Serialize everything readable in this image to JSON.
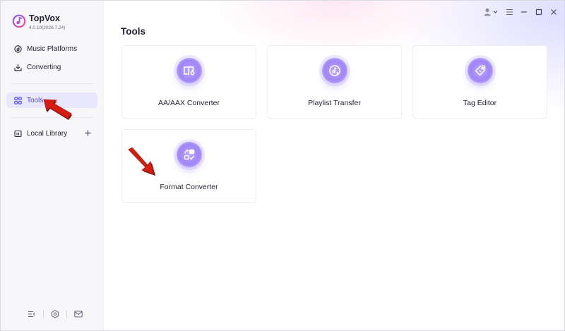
{
  "app": {
    "name": "TopVox",
    "version": "4.0.10(2026.7.24)"
  },
  "sidebar": {
    "items": [
      {
        "label": "Music Platforms",
        "icon": "music-platform-icon"
      },
      {
        "label": "Converting",
        "icon": "download-icon"
      },
      {
        "label": "Tools",
        "icon": "grid-icon",
        "active": true
      },
      {
        "label": "Local Library",
        "icon": "library-icon"
      }
    ],
    "bottom_icons": [
      "feedback-list-icon",
      "settings-hex-icon",
      "mail-icon"
    ]
  },
  "main": {
    "title": "Tools",
    "tools": [
      {
        "label": "AA/AAX Converter",
        "icon": "audiobook-icon"
      },
      {
        "label": "Playlist Transfer",
        "icon": "playlist-transfer-icon"
      },
      {
        "label": "Tag Editor",
        "icon": "tag-icon"
      },
      {
        "label": "Format Converter",
        "icon": "format-convert-icon"
      }
    ]
  },
  "colors": {
    "accent": "#4f46d8",
    "active_bg": "#e9e7fb",
    "icon_purple": "#9f85f5",
    "arrow_red": "#d61d12"
  }
}
